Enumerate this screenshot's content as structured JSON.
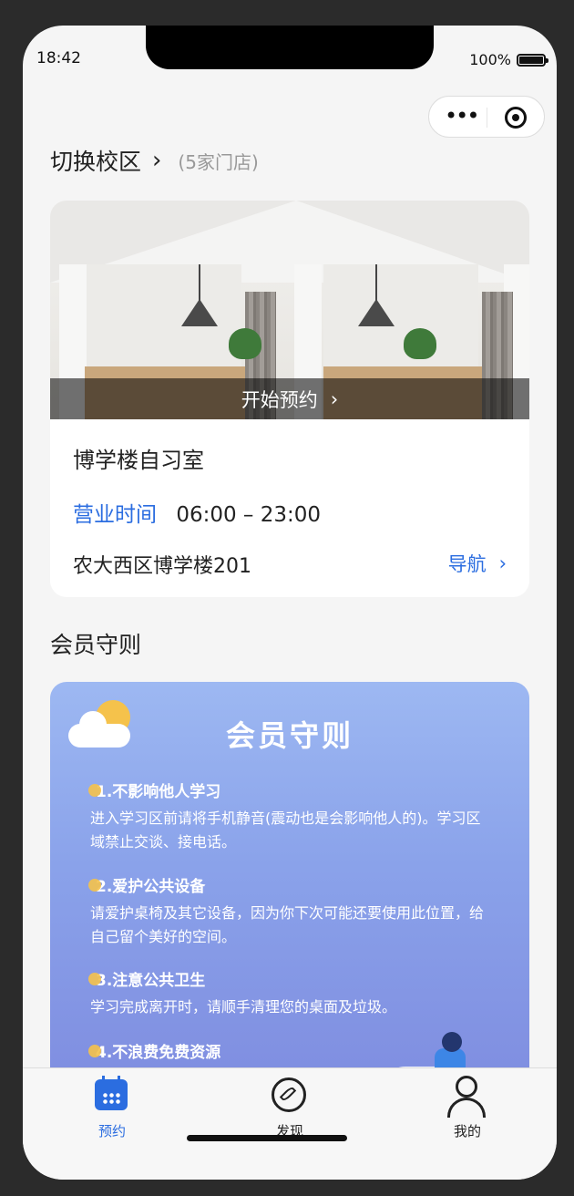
{
  "status": {
    "time": "18:42",
    "battery": "100%"
  },
  "header": {
    "campus_title": "切换校区",
    "store_count": "(5家门店)"
  },
  "store": {
    "cta": "开始预约",
    "name": "博学楼自习室",
    "hours_label": "营业时间",
    "hours": "06:00 – 23:00",
    "address": "农大西区博学楼201",
    "nav_label": "导航"
  },
  "rules": {
    "section_title": "会员守则",
    "card_title": "会员守则",
    "items": [
      {
        "title": "1.不影响他人学习",
        "body": "进入学习区前请将手机静音(震动也是会影响他人的)。学习区域禁止交谈、接电话。"
      },
      {
        "title": "2.爱护公共设备",
        "body": "请爱护桌椅及其它设备，因为你下次可能还要使用此位置，给自己留个美好的空间。"
      },
      {
        "title": "3.注意公共卫生",
        "body": "学习完成离开时，请顺手清理您的桌面及垃圾。"
      },
      {
        "title": "4.不浪费免费资源",
        "body": ""
      }
    ]
  },
  "tabbar": {
    "tabs": [
      {
        "label": "预约",
        "icon": "calendar-icon",
        "active": true
      },
      {
        "label": "发现",
        "icon": "compass-icon",
        "active": false
      },
      {
        "label": "我的",
        "icon": "person-icon",
        "active": false
      }
    ]
  },
  "colors": {
    "accent": "#2b6de0",
    "background": "#f5f5f5"
  }
}
